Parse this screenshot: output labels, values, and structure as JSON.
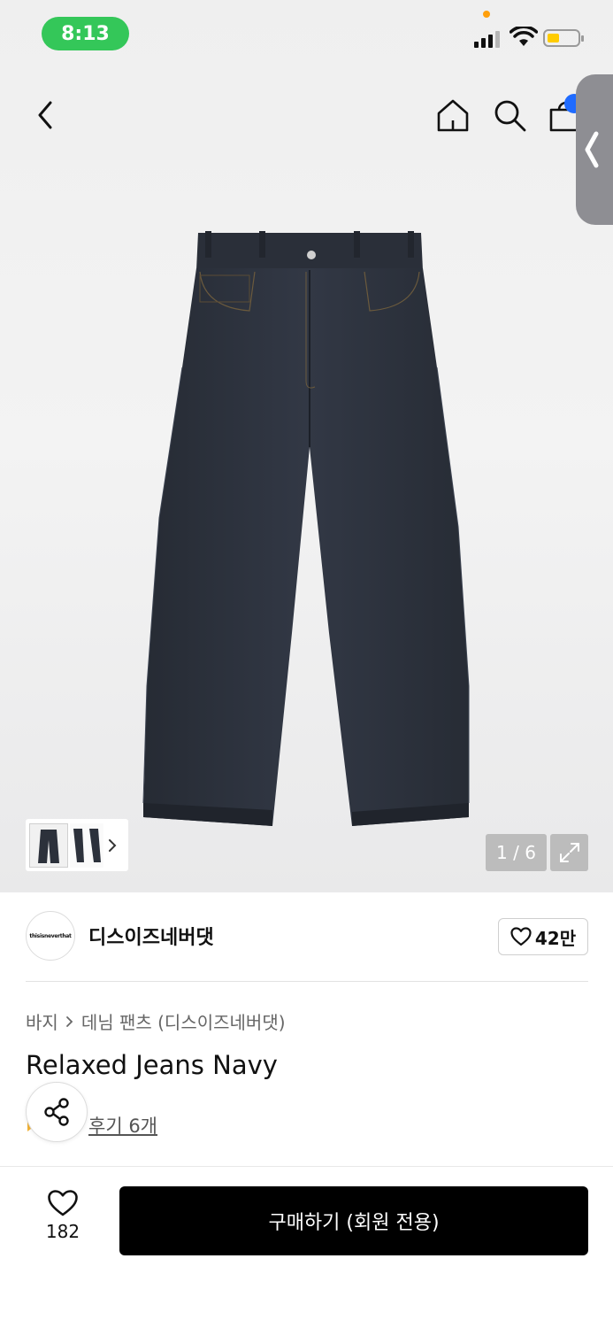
{
  "status_bar": {
    "time": "8:13"
  },
  "gallery": {
    "page_counter": "1 / 6"
  },
  "brand": {
    "logo_text": "thisisneverthat",
    "name": "디스이즈네버댓",
    "likes": "42만"
  },
  "breadcrumb": {
    "category": "바지",
    "subcategory": "데님 팬츠 (디스이즈네버댓)"
  },
  "product": {
    "title": "Relaxed Jeans Navy",
    "reviews": "후기 6개"
  },
  "bottom_bar": {
    "wish_count": "182",
    "buy_label": "구매하기 (회원 전용)"
  },
  "icons": {
    "back": "chevron-left-icon",
    "home": "home-icon",
    "search": "search-icon",
    "bag": "shopping-bag-icon",
    "share": "share-icon",
    "heart": "heart-icon",
    "expand": "expand-icon"
  },
  "colors": {
    "status_time_bg": "#34c759",
    "badge": "#1f6bff",
    "buy_button": "#000000",
    "denim": "#2b313c"
  }
}
